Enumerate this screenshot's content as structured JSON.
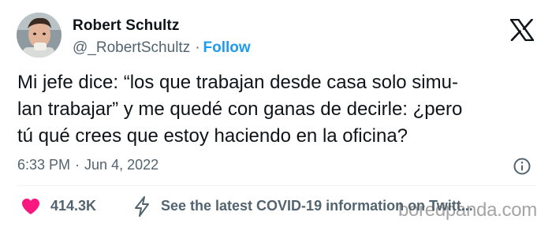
{
  "author": {
    "name": "Robert Schultz",
    "handle": "@_RobertSchultz",
    "separator": "·",
    "follow_label": "Follow",
    "avatar_icon": "profile-photo"
  },
  "platform": {
    "logo_icon": "x-logo-icon"
  },
  "tweet": {
    "lines": [
      "Mi jefe dice: “los que trabajan desde casa solo simu-",
      "lan trabajar” y me quedé con ganas de decirle: ¿pero",
      "tú qué crees que estoy haciendo en la oficina?"
    ],
    "time": "6:33 PM",
    "date_separator": "·",
    "date": "Jun 4, 2022",
    "info_icon": "info-icon"
  },
  "actions": {
    "like_icon": "heart-icon",
    "like_count": "414.3K",
    "covid_icon": "bolt-icon",
    "covid_label": "See the latest COVID-19 information on Twitt..."
  },
  "watermark": "boredpanda.com",
  "colors": {
    "accent": "#1d9bf0",
    "heart": "#f91880",
    "secondary_text": "#536471",
    "primary_text": "#0f1419",
    "divider": "#eff3f4"
  }
}
